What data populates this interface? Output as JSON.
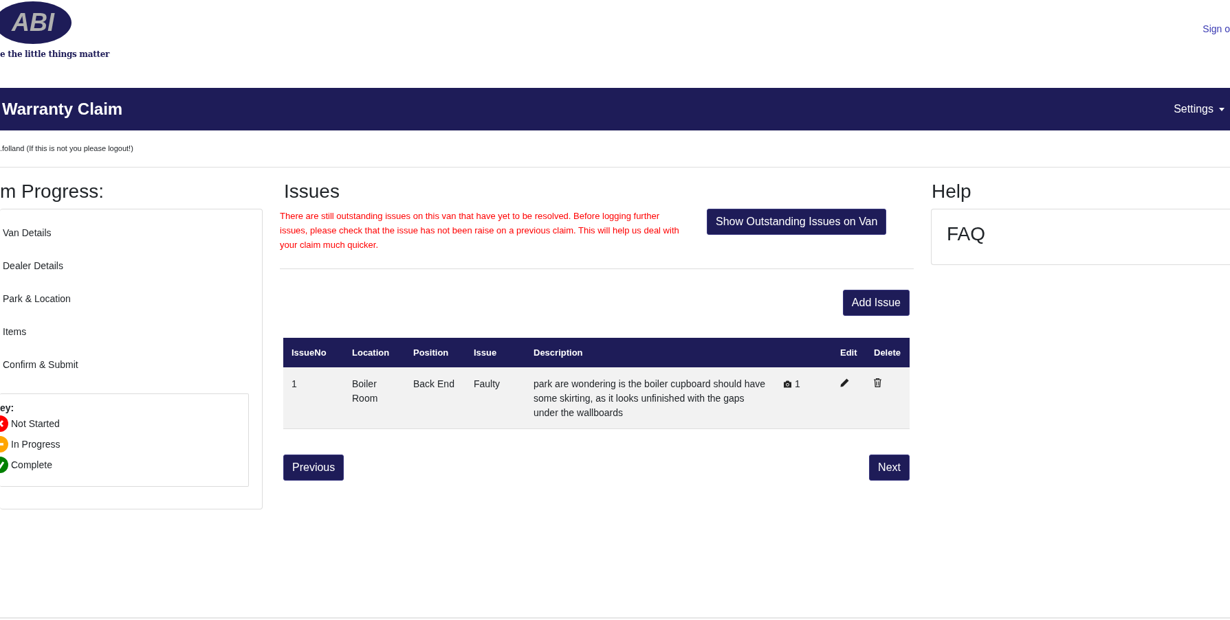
{
  "header": {
    "logo_text": "ABI",
    "tagline": "e the little things matter",
    "sign_out": "Sign o"
  },
  "navbar": {
    "title": "Warranty Claim",
    "settings": "Settings"
  },
  "user_notice": ".folland (If this is not you please logout!)",
  "progress": {
    "heading": "m Progress:",
    "items": [
      "Van Details",
      "Dealer Details",
      "Park & Location",
      "Items",
      "Confirm & Submit"
    ],
    "key": {
      "title": "ey:",
      "items": [
        {
          "kind": "cross",
          "color": "#ff0000",
          "label": "Not Started"
        },
        {
          "kind": "minus",
          "color": "#ffa500",
          "label": "In Progress"
        },
        {
          "kind": "check",
          "color": "#008000",
          "label": "Complete"
        }
      ]
    }
  },
  "issues": {
    "heading": "Issues",
    "warning": "There are still outstanding issues on this van that have yet to be resolved. Before logging further issues, please check that the issue has not been raise on a previous claim. This will help us deal with your claim much quicker.",
    "outstanding_button": "Show Outstanding Issues on Van",
    "add_button": "Add Issue",
    "table": {
      "columns": [
        "IssueNo",
        "Location",
        "Position",
        "Issue",
        "Description",
        "",
        "Edit",
        "Delete"
      ],
      "rows": [
        {
          "issue_no": "1",
          "location": "Boiler Room",
          "position": "Back End",
          "issue": "Faulty",
          "description": "park are wondering is the boiler cupboard should have some skirting, as it looks unfinished with the gaps under the wallboards",
          "photos": "1"
        }
      ]
    },
    "previous": "Previous",
    "next": "Next"
  },
  "help": {
    "heading": "Help",
    "faq": "FAQ"
  }
}
